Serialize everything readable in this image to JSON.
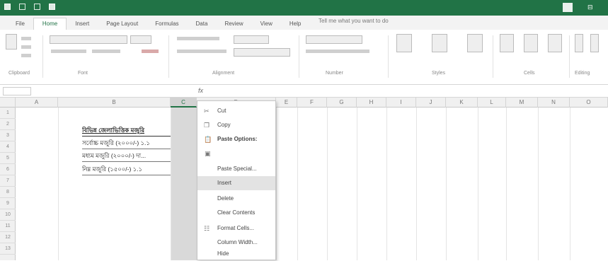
{
  "window": {
    "title": "",
    "account": "",
    "brand_color": "#217346"
  },
  "ribbon": {
    "tabs": [
      "File",
      "Home",
      "Insert",
      "Page Layout",
      "Formulas",
      "Data",
      "Review",
      "View",
      "Help"
    ],
    "active_tab": "Home",
    "tell_me": "Tell me what you want to do",
    "groups": [
      "Clipboard",
      "Font",
      "Alignment",
      "Number",
      "Styles",
      "Cells",
      "Editing"
    ]
  },
  "grid": {
    "columns": [
      "A",
      "B",
      "C",
      "D",
      "E",
      "F",
      "G",
      "H",
      "I",
      "J",
      "K",
      "L",
      "M",
      "N",
      "O"
    ],
    "selected_column": "C",
    "rows": [
      "1",
      "2",
      "3",
      "4",
      "5",
      "6",
      "7",
      "8",
      "9",
      "10",
      "11",
      "12",
      "13"
    ],
    "cells": [
      {
        "text": "বিভিন্ন জেলাভিত্তিক মজুরি",
        "style": "bold"
      },
      {
        "text": "সর্বোচ্চ মজুরি (২০০০/-) ১.১",
        "style": "normal"
      },
      {
        "text": "মধ্যম মজুরি (২০০০/-) দা...",
        "style": "normal"
      },
      {
        "text": "নিম্ন মজুরি (১৫০০/-) ১.১",
        "style": "normal"
      }
    ]
  },
  "context_menu": {
    "items": [
      {
        "label": "Cut",
        "icon": "scissors-icon"
      },
      {
        "label": "Copy",
        "icon": "copy-icon"
      },
      {
        "label": "Paste Options:",
        "icon": "paste-icon"
      },
      {
        "label": "",
        "icon": "paste-option-icon"
      },
      {
        "label": "Paste Special...",
        "icon": ""
      },
      {
        "label": "Insert",
        "icon": "",
        "hover": true
      },
      {
        "label": "Delete",
        "icon": ""
      },
      {
        "label": "Clear Contents",
        "icon": ""
      },
      {
        "label": "Format Cells...",
        "icon": "format-cells-icon"
      },
      {
        "label": "Column Width...",
        "icon": ""
      },
      {
        "label": "Hide",
        "icon": ""
      }
    ]
  }
}
